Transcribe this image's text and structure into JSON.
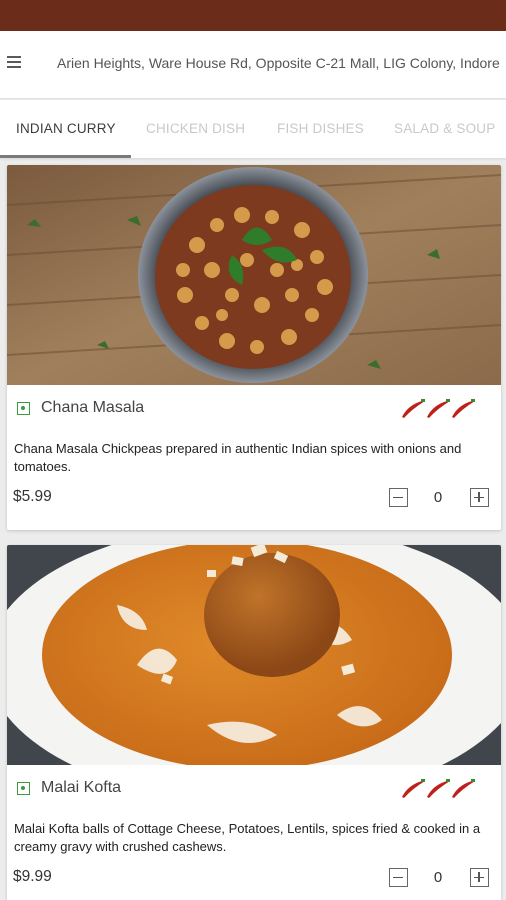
{
  "header": {
    "address": "Arien Heights, Ware House Rd, Opposite C-21 Mall, LIG Colony, Indore",
    "menu_icon": "hamburger-menu-icon"
  },
  "tabs": [
    {
      "label": "INDIAN CURRY",
      "active": true
    },
    {
      "label": "CHICKEN DISH",
      "active": false
    },
    {
      "label": "FISH DISHES",
      "active": false
    },
    {
      "label": "SALAD & SOUP",
      "active": false
    }
  ],
  "dishes": [
    {
      "name": "Chana Masala",
      "description": "Chana Masala Chickpeas prepared in authentic Indian spices with onions and tomatoes.",
      "price": "$5.99",
      "quantity": "0",
      "spice_level": 3,
      "veg": true
    },
    {
      "name": "Malai Kofta",
      "description": "Malai Kofta balls of Cottage Cheese, Potatoes, Lentils, spices fried & cooked in a creamy gravy with crushed cashews.",
      "price": "$9.99",
      "quantity": "0",
      "spice_level": 3,
      "veg": true
    }
  ],
  "colors": {
    "status_bar": "#6b2c19",
    "veg_mark": "#3d9a3d",
    "chili": "#c0201a"
  }
}
